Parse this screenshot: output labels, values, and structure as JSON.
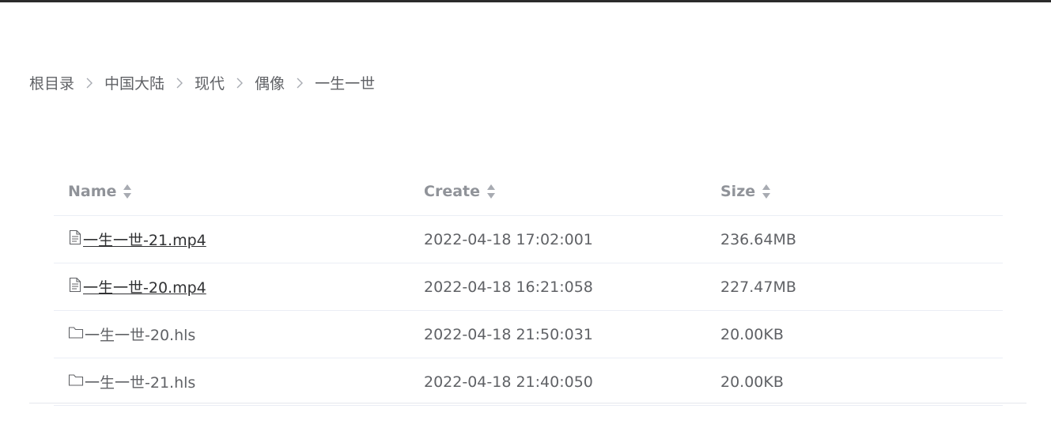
{
  "breadcrumb": {
    "items": [
      "根目录",
      "中国大陆",
      "现代",
      "偶像",
      "一生一世"
    ]
  },
  "table": {
    "headers": {
      "name": "Name",
      "create": "Create",
      "size": "Size"
    },
    "rows": [
      {
        "icon": "document-icon",
        "name": "一生一世-21.mp4",
        "create": "2022-04-18 17:02:001",
        "size": "236.64MB",
        "is_link": true
      },
      {
        "icon": "document-icon",
        "name": "一生一世-20.mp4",
        "create": "2022-04-18 16:21:058",
        "size": "227.47MB",
        "is_link": true
      },
      {
        "icon": "folder-icon",
        "name": "一生一世-20.hls",
        "create": "2022-04-18 21:50:031",
        "size": "20.00KB",
        "is_link": false
      },
      {
        "icon": "folder-icon",
        "name": "一生一世-21.hls",
        "create": "2022-04-18 21:40:050",
        "size": "20.00KB",
        "is_link": false
      }
    ]
  },
  "colors": {
    "text": "#606266",
    "header_text": "#909399",
    "link_text": "#303133",
    "divider": "#ebeef5",
    "topbar": "#2b2b2b"
  }
}
